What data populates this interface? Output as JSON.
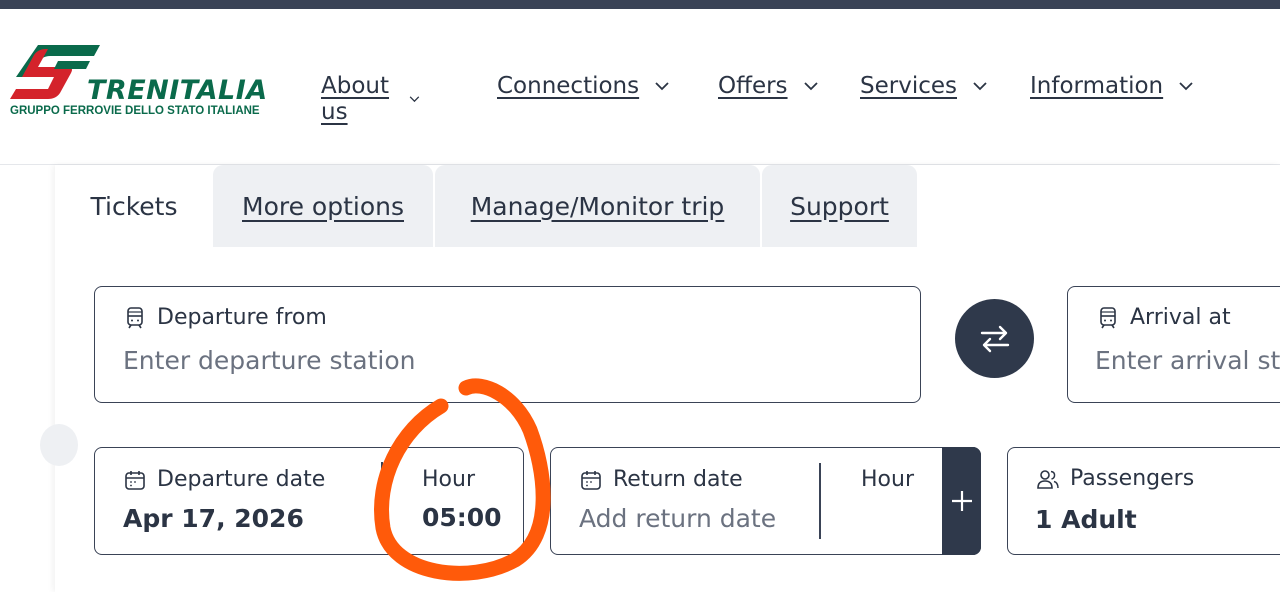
{
  "logo": {
    "name": "TRENITALIA",
    "subtitle": "GRUPPO FERROVIE DELLO STATO ITALIANE",
    "brand_green": "#0a6a4b",
    "brand_red": "#d4232b"
  },
  "nav": {
    "items": [
      {
        "label": "About us"
      },
      {
        "label": "Connections"
      },
      {
        "label": "Offers"
      },
      {
        "label": "Services"
      },
      {
        "label": "Information"
      }
    ]
  },
  "tabs": [
    {
      "label": "Tickets",
      "active": true
    },
    {
      "label": "More options"
    },
    {
      "label": "Manage/Monitor trip"
    },
    {
      "label": "Support"
    }
  ],
  "search": {
    "departure": {
      "label": "Departure from",
      "placeholder": "Enter departure station",
      "icon": "train-icon"
    },
    "arrival": {
      "label": "Arrival at",
      "placeholder": "Enter arrival st",
      "icon": "train-icon"
    },
    "swap_icon": "swap-arrows-icon",
    "departure_date": {
      "label": "Departure date",
      "value": "Apr 17, 2026",
      "icon": "calendar-icon"
    },
    "departure_hour": {
      "label": "Hour",
      "value": "05:00"
    },
    "return_date": {
      "label": "Return date",
      "placeholder": "Add return date",
      "icon": "calendar-icon"
    },
    "return_hour": {
      "label": "Hour"
    },
    "add_return_icon": "plus-icon",
    "passengers": {
      "label": "Passengers",
      "value": "1 Adult",
      "icon": "users-icon"
    }
  },
  "colors": {
    "dark": "#2f394b",
    "annotation": "#ff5a0a"
  }
}
